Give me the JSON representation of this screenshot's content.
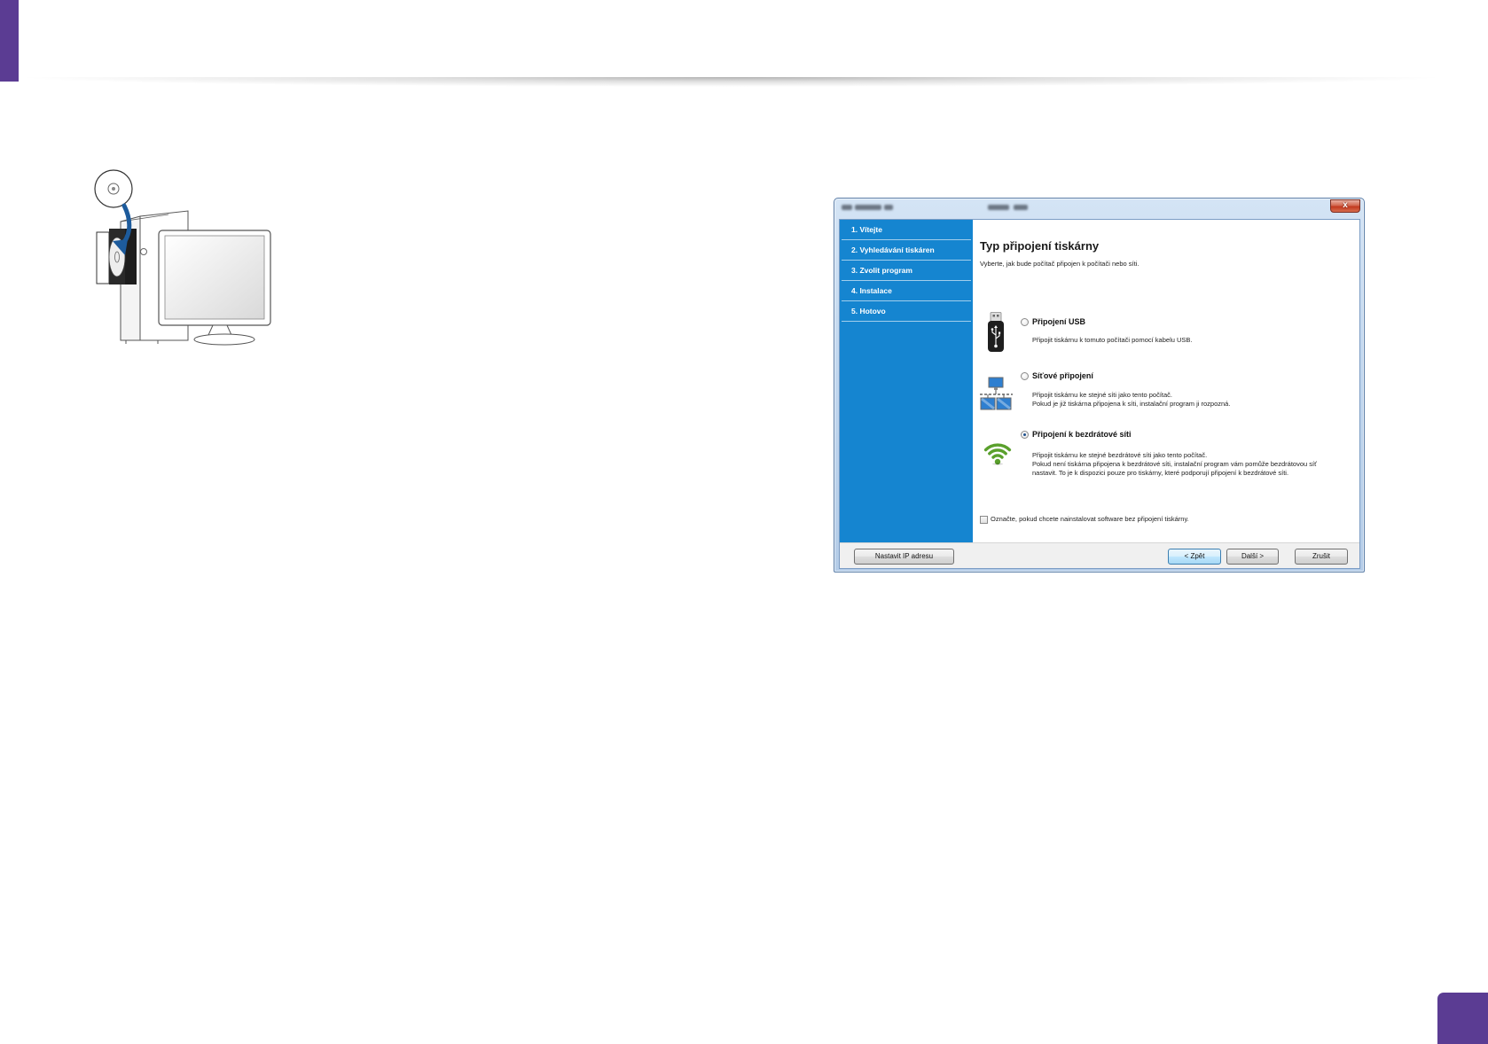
{
  "colors": {
    "accent": "#5b3c93",
    "sidebar": "#1585d0",
    "wifi_green": "#5aa02c",
    "arrow_blue": "#1d5b9c"
  },
  "illustration": {
    "icons": [
      "cd-disc-icon",
      "computer-tower-icon",
      "monitor-icon",
      "insert-arrow-icon"
    ]
  },
  "dialog": {
    "close_label": "x",
    "sidebar": {
      "items": [
        {
          "label": "1. Vítejte"
        },
        {
          "label": "2. Vyhledávání tiskáren"
        },
        {
          "label": "3. Zvolit program"
        },
        {
          "label": "4. Instalace"
        },
        {
          "label": "5. Hotovo"
        }
      ]
    },
    "main": {
      "title": "Typ připojení tiskárny",
      "subtitle": "Vyberte, jak bude počítač připojen k počítači nebo síti.",
      "options": [
        {
          "icon": "usb-icon",
          "label": "Připojení USB",
          "selected": false,
          "description": [
            "Připojit tiskárnu k tomuto počítači pomocí kabelu USB."
          ]
        },
        {
          "icon": "network-icon",
          "label": "Síťové připojení",
          "selected": false,
          "description": [
            "Připojit tiskárnu ke stejné síti jako tento počítač.",
            "Pokud je již tiskárna připojena k síti, instalační program ji rozpozná."
          ]
        },
        {
          "icon": "wifi-icon",
          "label": "Připojení k bezdrátové síti",
          "selected": true,
          "description": [
            "Připojit tiskárnu ke stejné bezdrátové síti jako tento počítač.",
            "Pokud není tiskárna připojena k bezdrátové síti, instalační program vám pomůže bezdrátovou síť",
            "nastavit. To je k dispozici pouze pro tiskárny, které podporují připojení k bezdrátové síti."
          ]
        }
      ],
      "checkbox": {
        "label": "Označte, pokud chcete nainstalovat software bez připojení tiskárny.",
        "checked": false
      }
    },
    "footer": {
      "set_ip_label": "Nastavit IP adresu",
      "back_label": "< Zpět",
      "next_label": "Další >",
      "cancel_label": "Zrušit"
    }
  }
}
